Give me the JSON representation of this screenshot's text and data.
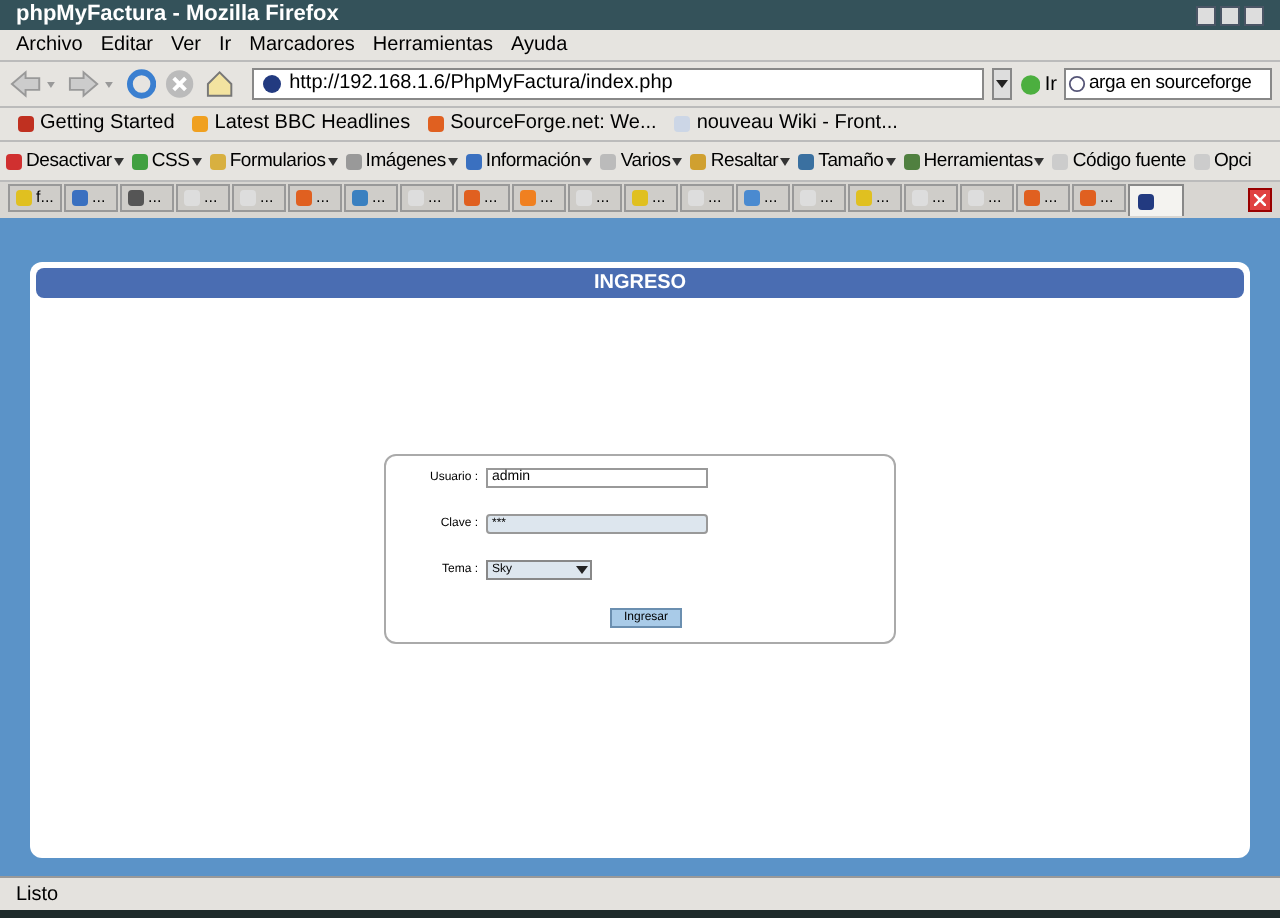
{
  "window": {
    "title": "phpMyFactura - Mozilla Firefox"
  },
  "menu": [
    "Archivo",
    "Editar",
    "Ver",
    "Ir",
    "Marcadores",
    "Herramientas",
    "Ayuda"
  ],
  "navigation": {
    "url": "http://192.168.1.6/PhpMyFactura/index.php",
    "go_label": "Ir",
    "search_value": "arga en sourceforge"
  },
  "bookmarks": [
    "Getting Started",
    "Latest BBC Headlines",
    "SourceForge.net: We...",
    "nouveau Wiki - Front..."
  ],
  "dev_toolbar": [
    {
      "label": "Desactivar",
      "dropdown": true
    },
    {
      "label": "CSS",
      "dropdown": true
    },
    {
      "label": "Formularios",
      "dropdown": true
    },
    {
      "label": "Imágenes",
      "dropdown": true
    },
    {
      "label": "Información",
      "dropdown": true
    },
    {
      "label": "Varios",
      "dropdown": true
    },
    {
      "label": "Resaltar",
      "dropdown": true
    },
    {
      "label": "Tamaño",
      "dropdown": true
    },
    {
      "label": "Herramientas",
      "dropdown": true
    },
    {
      "label": "Código fuente",
      "dropdown": false
    },
    {
      "label": "Opci",
      "dropdown": false
    }
  ],
  "tabs": [
    {
      "label": "f...",
      "selected": false
    },
    {
      "label": "...",
      "selected": false
    },
    {
      "label": "...",
      "selected": false
    },
    {
      "label": "...",
      "selected": false
    },
    {
      "label": "...",
      "selected": false
    },
    {
      "label": "...",
      "selected": false
    },
    {
      "label": "...",
      "selected": false
    },
    {
      "label": "...",
      "selected": false
    },
    {
      "label": "...",
      "selected": false
    },
    {
      "label": "...",
      "selected": false
    },
    {
      "label": "...",
      "selected": false
    },
    {
      "label": "...",
      "selected": false
    },
    {
      "label": "...",
      "selected": false
    },
    {
      "label": "...",
      "selected": false
    },
    {
      "label": "...",
      "selected": false
    },
    {
      "label": "...",
      "selected": false
    },
    {
      "label": "...",
      "selected": false
    },
    {
      "label": "...",
      "selected": false
    },
    {
      "label": "...",
      "selected": false
    },
    {
      "label": "...",
      "selected": false
    },
    {
      "selected": true
    }
  ],
  "page": {
    "header": "INGRESO",
    "fields": [
      {
        "kind": "text",
        "label": "Usuario :",
        "value": "admin"
      },
      {
        "kind": "password",
        "label": "Clave :",
        "value": "***"
      },
      {
        "kind": "select",
        "label": "Tema :",
        "value": "Sky"
      }
    ],
    "submit": "Ingresar"
  },
  "status_bar": "Listo"
}
